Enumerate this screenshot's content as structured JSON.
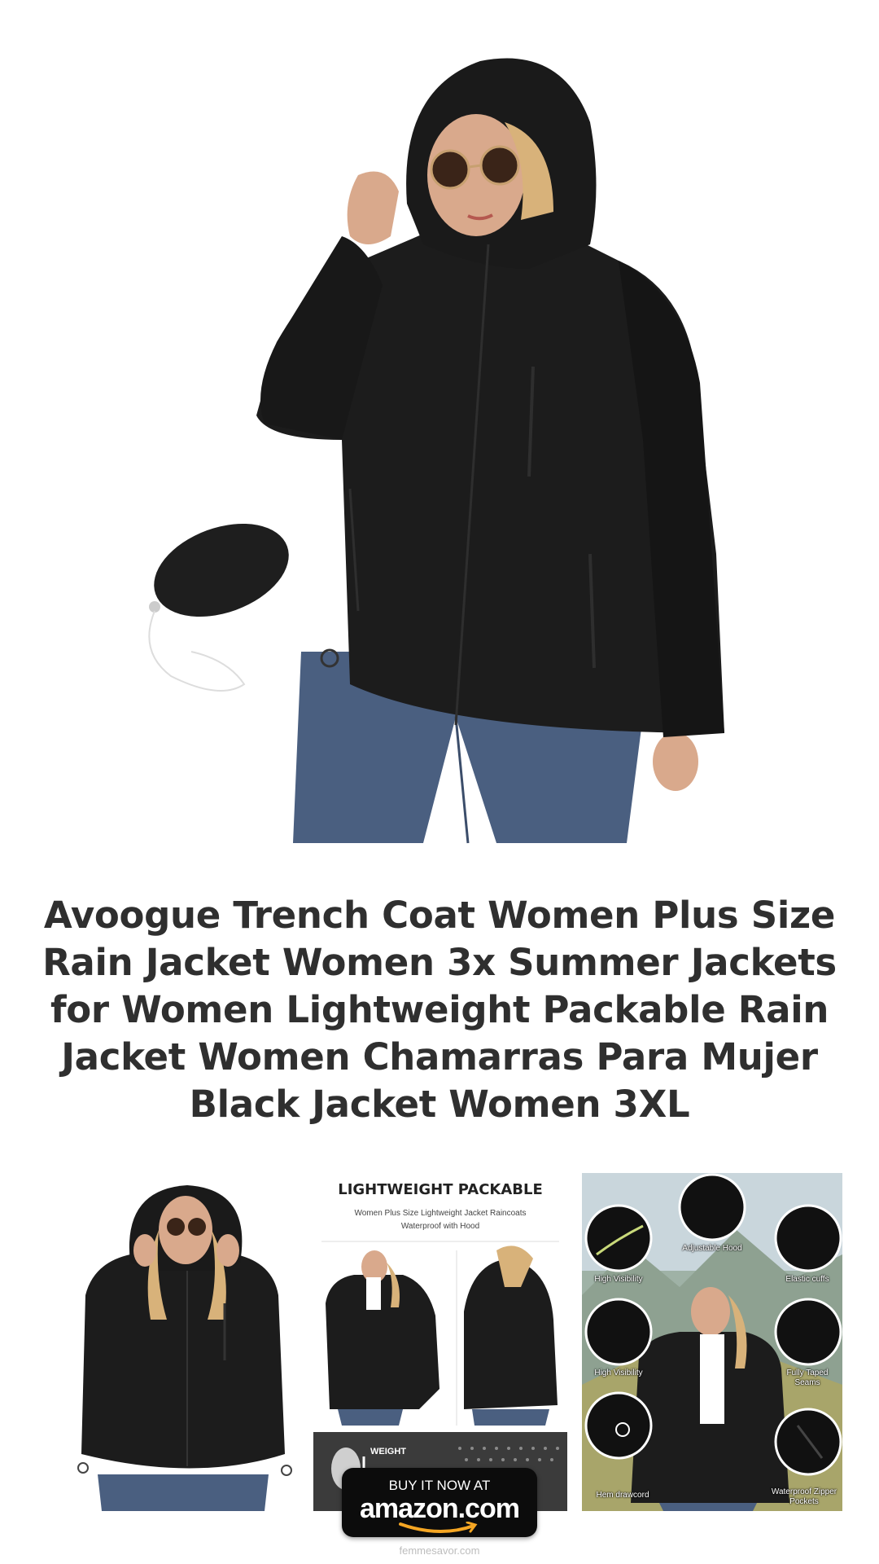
{
  "product": {
    "title": "Avoogue Trench Coat Women Plus Size Rain Jacket Women 3x Summer Jackets for Women Lightweight Packable Rain Jacket Women Chamarras Para Mujer Black Jacket Women 3XL"
  },
  "gallery": {
    "packable": {
      "title": "LIGHTWEIGHT PACKABLE",
      "subtitle_line1": "Women Plus Size Lightweight Jacket Raincoats",
      "subtitle_line2": "Waterproof with Hood",
      "weight_label": "WEIGHT"
    },
    "features": {
      "adjustable_hood": "Adjustable Hood",
      "high_visibility_1": "High Visibility",
      "elastic_cuffs": "Elastic cuffs",
      "high_visibility_2": "High Visibility",
      "fully_taped_seams_1": "Fully Taped",
      "fully_taped_seams_2": "Seams",
      "hem_drawcord": "Hem drawcord",
      "zipper_pockets_1": "Waterproof Zipper",
      "zipper_pockets_2": "Pockets"
    }
  },
  "cta": {
    "line1": "BUY IT NOW AT",
    "line2": "amazon.com"
  },
  "footer": {
    "site": "femmesavor.com"
  },
  "colors": {
    "jacket": "#1c1c1c",
    "jeans": "#4a5f80",
    "skin": "#d9a98c",
    "amazon_smile": "#f5a623",
    "text": "#2f2f2f"
  }
}
